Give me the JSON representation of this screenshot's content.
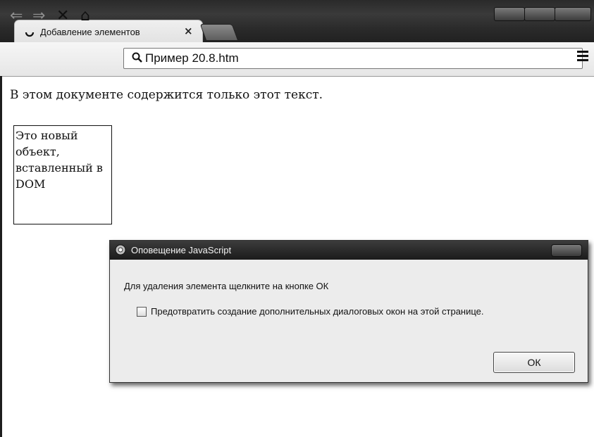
{
  "browser": {
    "tab": {
      "title": "Добавление элементов",
      "close": "×"
    },
    "toolbar": {
      "back": "⇐",
      "forward": "⇒",
      "stop": "✕",
      "home": "⌂",
      "address": "Пример 20.8.htm"
    }
  },
  "page": {
    "paragraph": "В этом документе содержится только этот текст.",
    "inserted_object": "Это новый объект, вставленный в DOM"
  },
  "dialog": {
    "title": "Оповещение JavaScript",
    "message": "Для удаления элемента щелкните на кнопке ОК",
    "checkbox_label": "Предотвратить создание дополнительных диалоговых окон на этой странице.",
    "ok_label": "ОК"
  },
  "icons": {
    "favicon": "loading-spinner-icon",
    "search": "magnifier-icon",
    "menu": "hamburger-menu-icon",
    "dialog": "chrome-icon"
  }
}
